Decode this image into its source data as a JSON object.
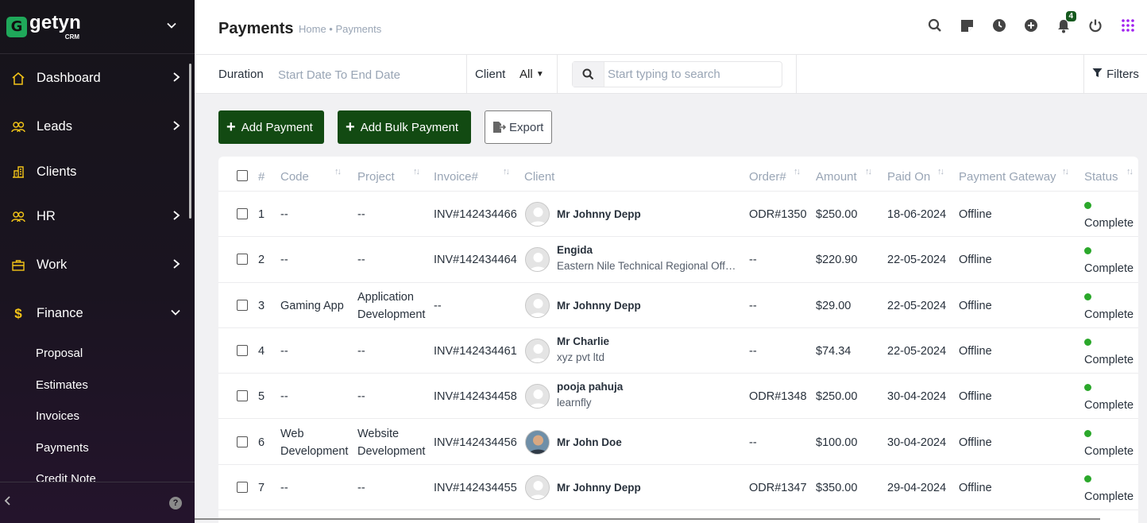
{
  "brand": {
    "logo_letter": "G",
    "name": "getyn",
    "sub": "CRM"
  },
  "sidebar": {
    "items": [
      {
        "label": "Dashboard",
        "icon": "home-icon"
      },
      {
        "label": "Leads",
        "icon": "users-icon"
      },
      {
        "label": "Clients",
        "icon": "building-icon"
      },
      {
        "label": "HR",
        "icon": "users-icon"
      },
      {
        "label": "Work",
        "icon": "briefcase-icon"
      },
      {
        "label": "Finance",
        "icon": "dollar-icon"
      }
    ],
    "finance_sub": [
      "Proposal",
      "Estimates",
      "Invoices",
      "Payments",
      "Credit Note"
    ],
    "help": "?"
  },
  "header": {
    "title": "Payments",
    "breadcrumb": "Home • Payments",
    "notification_count": "4"
  },
  "filters": {
    "duration_label": "Duration",
    "duration_value": "Start Date To End Date",
    "client_label": "Client",
    "client_value": "All",
    "search_placeholder": "Start typing to search",
    "filters_label": "Filters"
  },
  "actions": {
    "add_payment": "Add Payment",
    "add_bulk_payment": "Add Bulk Payment",
    "export": "Export"
  },
  "table": {
    "headers": {
      "num": "#",
      "code": "Code",
      "project": "Project",
      "invoice": "Invoice#",
      "client": "Client",
      "order": "Order#",
      "amount": "Amount",
      "paid_on": "Paid On",
      "gateway": "Payment Gateway",
      "status": "Status"
    },
    "rows": [
      {
        "num": "1",
        "code": "--",
        "project": "--",
        "invoice": "INV#142434466",
        "client_name": "Mr Johnny Depp",
        "client_company": "",
        "photo": false,
        "order": "ODR#1350",
        "amount": "$250.00",
        "paid_on": "18-06-2024",
        "gateway": "Offline",
        "status": "Complete"
      },
      {
        "num": "2",
        "code": "--",
        "project": "--",
        "invoice": "INV#142434464",
        "client_name": "Engida",
        "client_company": "Eastern Nile Technical Regional Offic...",
        "photo": false,
        "order": "--",
        "amount": "$220.90",
        "paid_on": "22-05-2024",
        "gateway": "Offline",
        "status": "Complete"
      },
      {
        "num": "3",
        "code": "Gaming App",
        "project": "Application Development",
        "invoice": "--",
        "client_name": "Mr Johnny Depp",
        "client_company": "",
        "photo": false,
        "order": "--",
        "amount": "$29.00",
        "paid_on": "22-05-2024",
        "gateway": "Offline",
        "status": "Complete"
      },
      {
        "num": "4",
        "code": "--",
        "project": "--",
        "invoice": "INV#142434461",
        "client_name": "Mr Charlie",
        "client_company": "xyz pvt ltd",
        "photo": false,
        "order": "--",
        "amount": "$74.34",
        "paid_on": "22-05-2024",
        "gateway": "Offline",
        "status": "Complete"
      },
      {
        "num": "5",
        "code": "--",
        "project": "--",
        "invoice": "INV#142434458",
        "client_name": "pooja pahuja",
        "client_company": "learnfly",
        "photo": false,
        "order": "ODR#1348",
        "amount": "$250.00",
        "paid_on": "30-04-2024",
        "gateway": "Offline",
        "status": "Complete"
      },
      {
        "num": "6",
        "code": "Web Development",
        "project": "Website Development",
        "invoice": "INV#142434456",
        "client_name": "Mr John Doe",
        "client_company": "",
        "photo": true,
        "order": "--",
        "amount": "$100.00",
        "paid_on": "30-04-2024",
        "gateway": "Offline",
        "status": "Complete"
      },
      {
        "num": "7",
        "code": "--",
        "project": "--",
        "invoice": "INV#142434455",
        "client_name": "Mr Johnny Depp",
        "client_company": "",
        "photo": false,
        "order": "ODR#1347",
        "amount": "$350.00",
        "paid_on": "29-04-2024",
        "gateway": "Offline",
        "status": "Complete"
      }
    ]
  },
  "colors": {
    "accent": "#124a12",
    "status_complete": "#2ba82b",
    "sidebar_bg": "#16141a"
  }
}
